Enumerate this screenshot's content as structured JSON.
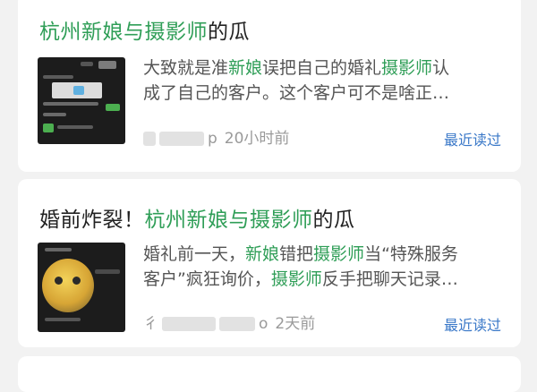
{
  "feed": {
    "items": [
      {
        "title_highlight": "杭州新娘与摄影师",
        "title_suffix": "的瓜",
        "excerpt_line1_a": "大致就是准",
        "excerpt_line1_b": "新娘",
        "excerpt_line1_c": "误把自己的婚礼",
        "excerpt_line1_d": "摄影师",
        "excerpt_line1_e": "认",
        "excerpt_line2": "成了自己的客户。这个客户可不是啥正…",
        "source_partial": "p",
        "time": "20小时前",
        "action": "最近读过",
        "thumbnail": "chat-screenshot-thumbnail"
      },
      {
        "title_prefix": "婚前炸裂！",
        "title_highlight": "杭州新娘与摄影师",
        "title_suffix": "的瓜",
        "excerpt_line1_a": "婚礼前一天，",
        "excerpt_line1_b": "新娘",
        "excerpt_line1_c": "错把",
        "excerpt_line1_d": "摄影师",
        "excerpt_line1_e": "当“特殊服务",
        "excerpt_line2_a": "客户”疯狂询价，",
        "excerpt_line2_b": "摄影师",
        "excerpt_line2_c": "反手把聊天记录…",
        "source_partial": "彳",
        "source_partial2": "o",
        "time": "2天前",
        "action": "最近读过",
        "thumbnail": "emoji-chat-thumbnail"
      }
    ]
  },
  "colors": {
    "highlight": "#2f9e57",
    "link": "#3a78c8",
    "muted": "#9a9a9a"
  }
}
